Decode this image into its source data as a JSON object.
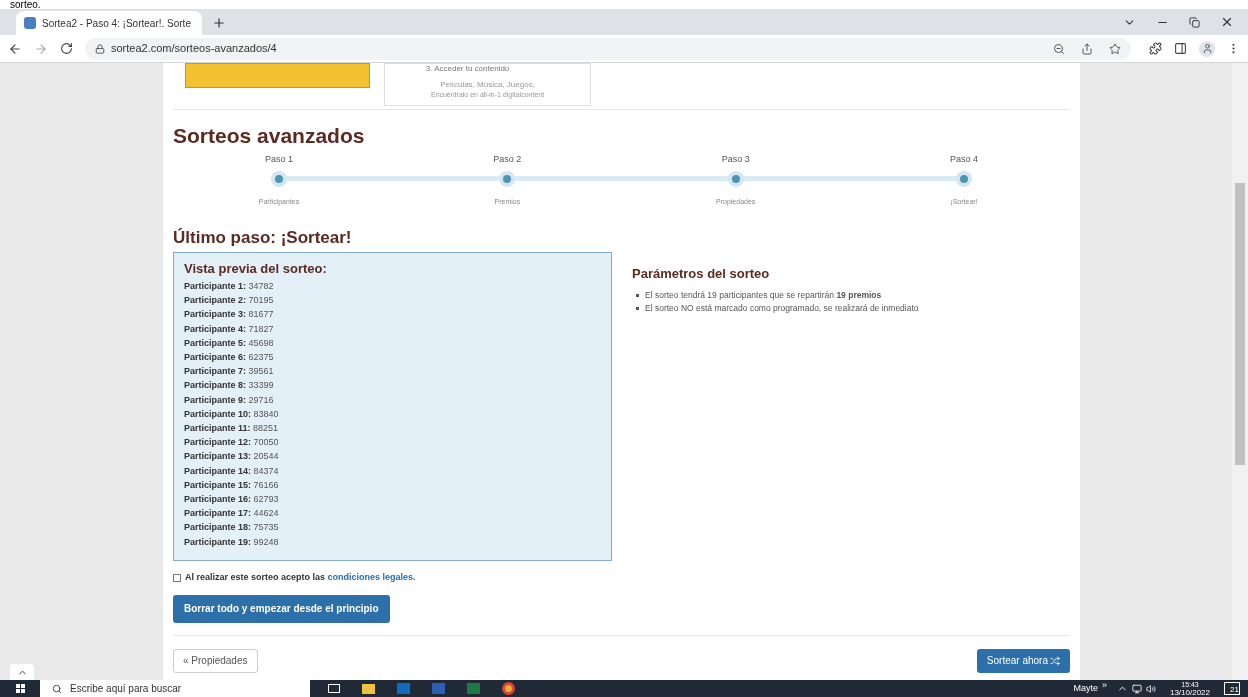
{
  "top_caption": "sorteo.",
  "browser": {
    "tab_title": "Sortea2 - Paso 4: ¡Sortear!. Sorte",
    "url": "sortea2.com/sorteos-avanzados/4"
  },
  "promo_card": {
    "lines": [
      "3. Acceder tu contenido",
      "Películas, Música, Juegos,",
      "Encuéntralo en all-in-1 digitalcontent"
    ]
  },
  "title": "Sorteos avanzados",
  "steps": [
    {
      "label": "Paso 1",
      "caption": "Participantes"
    },
    {
      "label": "Paso 2",
      "caption": "Premios"
    },
    {
      "label": "Paso 3",
      "caption": "Propiedades"
    },
    {
      "label": "Paso 4",
      "caption": "¡Sortear!"
    }
  ],
  "subtitle": "Último paso: ¡Sortear!",
  "preview": {
    "title": "Vista previa del sorteo:",
    "participants": [
      {
        "label": "Participante 1:",
        "value": "34782"
      },
      {
        "label": "Participante 2:",
        "value": "70195"
      },
      {
        "label": "Participante 3:",
        "value": "81677"
      },
      {
        "label": "Participante 4:",
        "value": "71827"
      },
      {
        "label": "Participante 5:",
        "value": "45698"
      },
      {
        "label": "Participante 6:",
        "value": "62375"
      },
      {
        "label": "Participante 7:",
        "value": "39561"
      },
      {
        "label": "Participante 8:",
        "value": "33399"
      },
      {
        "label": "Participante 9:",
        "value": "29716"
      },
      {
        "label": "Participante 10:",
        "value": "83840"
      },
      {
        "label": "Participante 11:",
        "value": "88251"
      },
      {
        "label": "Participante 12:",
        "value": "70050"
      },
      {
        "label": "Participante 13:",
        "value": "20544"
      },
      {
        "label": "Participante 14:",
        "value": "84374"
      },
      {
        "label": "Participante 15:",
        "value": "76166"
      },
      {
        "label": "Participante 16:",
        "value": "62793"
      },
      {
        "label": "Participante 17:",
        "value": "44624"
      },
      {
        "label": "Participante 18:",
        "value": "75735"
      },
      {
        "label": "Participante 19:",
        "value": "99248"
      }
    ]
  },
  "parameters": {
    "title": "Parámetros del sorteo",
    "items": [
      "El sorteo tendrá 19 participantes que se repartirán **19 premios**",
      "El sorteo NO está marcado como programado, se realizará de inmediato"
    ]
  },
  "terms": {
    "checked": false,
    "text": "Al realizar este sorteo acepto las",
    "link": "condiciones legales."
  },
  "reset_button": "Borrar todo y empezar desde el principio",
  "back_button": "« Propiedades",
  "submit_button": "Sortear ahora",
  "taskbar": {
    "search_placeholder": "Escribe aquí para buscar",
    "user": "Mayte",
    "chevron": "»",
    "time": "15:43",
    "date": "13/10/2022",
    "notifications": "21"
  }
}
